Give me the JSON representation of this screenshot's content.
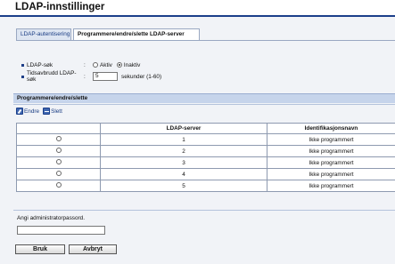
{
  "page": {
    "title": "LDAP-innstillinger"
  },
  "tabs": [
    {
      "label": "LDAP-autentisering",
      "active": false
    },
    {
      "label": "Programmere/endre/slette LDAP-server",
      "active": true
    }
  ],
  "settings": {
    "ldap_search": {
      "label": "LDAP-søk",
      "options": [
        "Aktiv",
        "Inaktiv"
      ],
      "selected": "Inaktiv"
    },
    "timeout": {
      "label": "Tidsavbrudd LDAP-søk",
      "value": "5",
      "unit": "sekunder (1-60)"
    }
  },
  "section": {
    "title": "Programmere/endre/slette"
  },
  "toolbar": {
    "edit_label": "Endre",
    "delete_label": "Slett"
  },
  "table": {
    "columns": [
      "",
      "LDAP-server",
      "Identifikasjonsnavn"
    ],
    "rows": [
      {
        "server": "1",
        "name": "Ikke programmert"
      },
      {
        "server": "2",
        "name": "Ikke programmert"
      },
      {
        "server": "3",
        "name": "Ikke programmert"
      },
      {
        "server": "4",
        "name": "Ikke programmert"
      },
      {
        "server": "5",
        "name": "Ikke programmert"
      }
    ]
  },
  "password": {
    "label": "Angi administratorpassord.",
    "value": ""
  },
  "buttons": {
    "apply": "Bruk",
    "cancel": "Avbryt"
  },
  "colors": {
    "header_bar": "#1b3f8a",
    "section_bar": "#c6d4eb",
    "page_bg": "#f1f3f7"
  }
}
